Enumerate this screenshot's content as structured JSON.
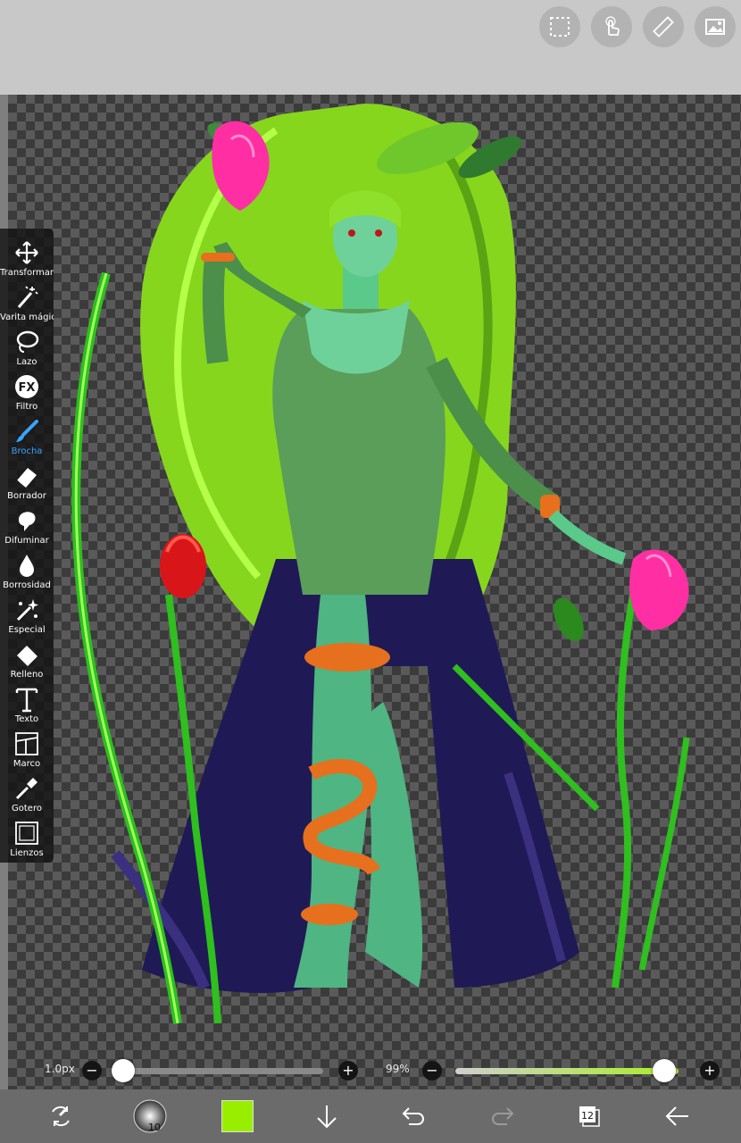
{
  "toolbox": {
    "items": [
      {
        "label": "Transformar",
        "icon": "move-arrows-icon"
      },
      {
        "label": "Varita mágica",
        "icon": "magic-wand-icon"
      },
      {
        "label": "Lazo",
        "icon": "lasso-icon"
      },
      {
        "label": "Filtro",
        "icon": "fx-icon"
      },
      {
        "label": "Brocha",
        "icon": "brush-icon"
      },
      {
        "label": "Borrador",
        "icon": "eraser-icon"
      },
      {
        "label": "Difuminar",
        "icon": "smudge-icon"
      },
      {
        "label": "Borrosidad",
        "icon": "blur-drop-icon"
      },
      {
        "label": "Especial",
        "icon": "sparkle-icon"
      },
      {
        "label": "Relleno",
        "icon": "fill-bucket-icon"
      },
      {
        "label": "Texto",
        "icon": "text-icon"
      },
      {
        "label": "Marco",
        "icon": "frame-icon"
      },
      {
        "label": "Gotero",
        "icon": "eyedropper-icon"
      },
      {
        "label": "Lienzos",
        "icon": "canvas-icon"
      }
    ],
    "active": "Brocha"
  },
  "brush_size": {
    "value_label": "1.0px",
    "level": 0.0
  },
  "opacity": {
    "value_label": "99%",
    "level": 0.99
  },
  "bottom_bar": {
    "brush_size_badge": "10",
    "current_color": "#99ee00",
    "layers_count": "12"
  },
  "colors": {
    "accent_active_tool": "#3aa3ff",
    "opacity_track": "#a8ee22"
  }
}
